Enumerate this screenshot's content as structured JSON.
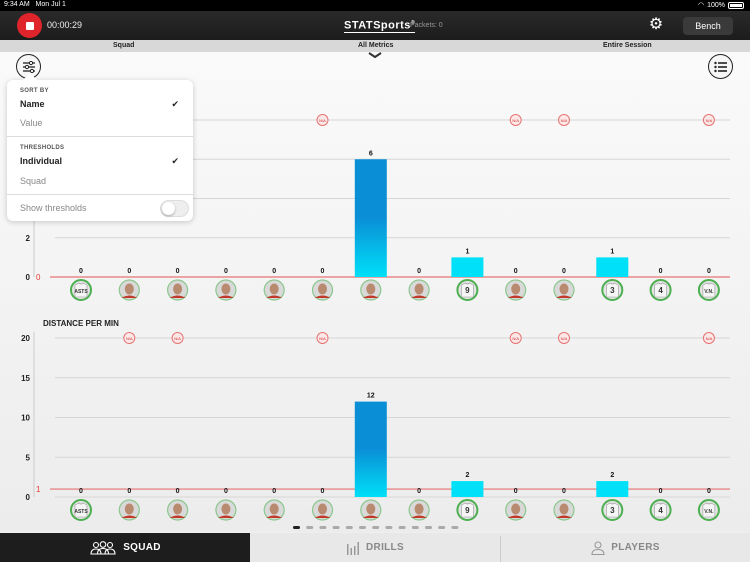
{
  "status_bar": {
    "time": "9:34 AM",
    "date": "Mon Jul 1",
    "battery": "100%"
  },
  "top_bar": {
    "timer": "00:00:29",
    "logo": "STATSports",
    "packets": "Packets: 0",
    "bench_label": "Bench"
  },
  "filter_bar": {
    "group": "Squad",
    "metric": "All Metrics",
    "period": "Entire Session"
  },
  "popover": {
    "sort_by_label": "SORT BY",
    "sort_options": [
      {
        "label": "Name",
        "selected": true
      },
      {
        "label": "Value",
        "selected": false
      }
    ],
    "thresholds_label": "THRESHOLDS",
    "threshold_options": [
      {
        "label": "Individual",
        "selected": true
      },
      {
        "label": "Squad",
        "selected": false
      }
    ],
    "show_thresholds_label": "Show thresholds",
    "show_thresholds_on": false,
    "check_glyph": "✔"
  },
  "players": [
    {
      "type": "jersey",
      "label": "ASTS"
    },
    {
      "type": "photo",
      "label": ""
    },
    {
      "type": "photo",
      "label": ""
    },
    {
      "type": "photo",
      "label": ""
    },
    {
      "type": "photo",
      "label": ""
    },
    {
      "type": "photo",
      "label": ""
    },
    {
      "type": "photo",
      "label": ""
    },
    {
      "type": "photo",
      "label": ""
    },
    {
      "type": "jersey",
      "label": "9"
    },
    {
      "type": "photo",
      "label": ""
    },
    {
      "type": "photo",
      "label": ""
    },
    {
      "type": "jersey",
      "label": "3"
    },
    {
      "type": "jersey",
      "label": "4"
    },
    {
      "type": "jersey",
      "label": "V.N."
    }
  ],
  "chart_data": [
    {
      "type": "bar",
      "title": "",
      "ylabel": "",
      "yticks_visible": [
        "0",
        "2"
      ],
      "ylim": [
        0,
        8
      ],
      "gridlines": [
        0,
        2,
        4,
        6,
        8
      ],
      "threshold_value_label": "0",
      "threshold_line": 0,
      "values": [
        0,
        0,
        0,
        0,
        0,
        0,
        6,
        0,
        1,
        0,
        0,
        1,
        0,
        0
      ],
      "value_labels": [
        "0",
        "0",
        "0",
        "0",
        "0",
        "0",
        "6",
        "0",
        "1",
        "0",
        "0",
        "1",
        "0",
        "0"
      ],
      "threshold_badges": [
        5,
        9,
        10,
        13
      ],
      "badge_text": "N/A"
    },
    {
      "type": "bar",
      "title": "DISTANCE PER MIN",
      "ylabel": "",
      "yticks": [
        "0",
        "5",
        "10",
        "15",
        "20"
      ],
      "ylim": [
        0,
        20
      ],
      "gridlines": [
        0,
        5,
        10,
        15,
        20
      ],
      "threshold_value_label": "1",
      "threshold_line": 1,
      "values": [
        0,
        0,
        0,
        0,
        0,
        0,
        12,
        0,
        2,
        0,
        0,
        2,
        0,
        0
      ],
      "value_labels": [
        "0",
        "0",
        "0",
        "0",
        "0",
        "0",
        "12",
        "0",
        "2",
        "0",
        "0",
        "2",
        "0",
        "0"
      ],
      "threshold_badges": [
        1,
        2,
        5,
        9,
        10,
        13
      ],
      "badge_text": "N/A"
    }
  ],
  "pagination": {
    "pages": 13,
    "current": 1
  },
  "tabs": [
    {
      "label": "SQUAD",
      "icon": "squad-icon",
      "active": true
    },
    {
      "label": "DRILLS",
      "icon": "bar-chart-icon",
      "active": false
    },
    {
      "label": "PLAYERS",
      "icon": "player-icon",
      "active": false
    }
  ],
  "colors": {
    "record": "#e0242c",
    "bar_top": "#0a8fd6",
    "bar_bottom": "#00e0f8",
    "threshold": "#e57373",
    "avatar_ring": "#4caf50"
  }
}
